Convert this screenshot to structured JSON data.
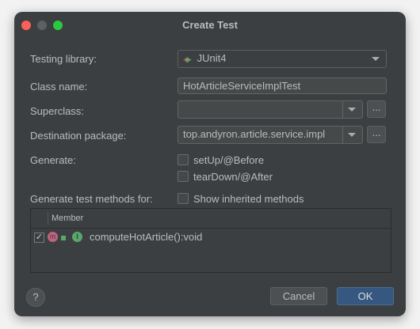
{
  "window": {
    "title": "Create Test"
  },
  "form": {
    "testing_library": {
      "label": "Testing library:",
      "value": "JUnit4",
      "icon": "junit-icon"
    },
    "class_name": {
      "label": "Class name:",
      "value": "HotArticleServiceImplTest"
    },
    "superclass": {
      "label": "Superclass:",
      "value": "",
      "browse": "..."
    },
    "destination_package": {
      "label": "Destination package:",
      "value": "top.andyron.article.service.impl",
      "browse": "..."
    },
    "generate": {
      "label": "Generate:",
      "options": [
        {
          "label": "setUp/@Before",
          "checked": false
        },
        {
          "label": "tearDown/@After",
          "checked": false
        }
      ]
    },
    "methods": {
      "label": "Generate test methods for:",
      "show_inherited": {
        "label": "Show inherited methods",
        "checked": false
      }
    }
  },
  "table": {
    "header": "Member",
    "rows": [
      {
        "checked": true,
        "name": "computeHotArticle():void"
      }
    ]
  },
  "buttons": {
    "help": "?",
    "cancel": "Cancel",
    "ok": "OK"
  },
  "colors": {
    "accent": "#365880",
    "background": "#3c3f41"
  }
}
